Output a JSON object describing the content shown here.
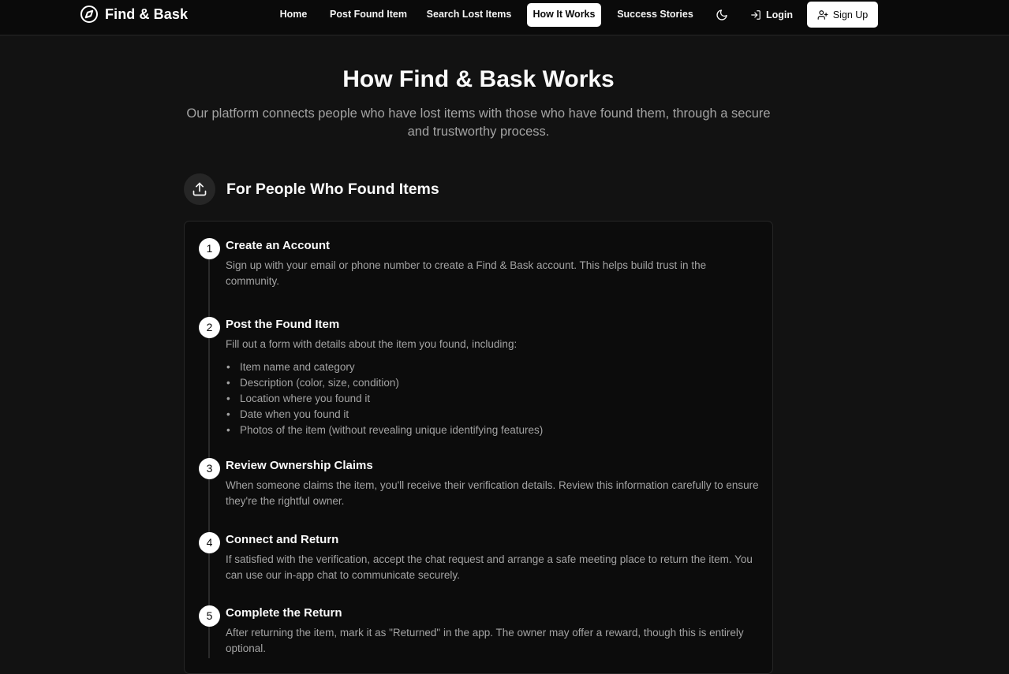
{
  "header": {
    "brand_name": "Find & Bask",
    "nav": [
      {
        "label": "Home"
      },
      {
        "label": "Post Found Item"
      },
      {
        "label": "Search Lost Items"
      },
      {
        "label": "How It Works"
      },
      {
        "label": "Success Stories"
      }
    ],
    "active_nav": "How It Works",
    "theme_toggle_icon": "moon-icon",
    "login_label": "Login",
    "signup_label": "Sign Up"
  },
  "main": {
    "title": "How Find & Bask Works",
    "subtitle": "Our platform connects people who have lost items with those who have found them, through a secure and trustworthy process.",
    "section": {
      "icon": "upload-icon",
      "title": "For People Who Found Items",
      "steps": [
        {
          "number": "1",
          "title": "Create an Account",
          "description": "Sign up with your email or phone number to create a Find & Bask account. This helps build trust in the community."
        },
        {
          "number": "2",
          "title": "Post the Found Item",
          "description": "Fill out a form with details about the item you found, including:",
          "list": [
            "Item name and category",
            "Description (color, size, condition)",
            "Location where you found it",
            "Date when you found it",
            "Photos of the item (without revealing unique identifying features)"
          ]
        },
        {
          "number": "3",
          "title": "Review Ownership Claims",
          "description": "When someone claims the item, you'll receive their verification details. Review this information carefully to ensure they're the rightful owner."
        },
        {
          "number": "4",
          "title": "Connect and Return",
          "description": "If satisfied with the verification, accept the chat request and arrange a safe meeting place to return the item. You can use our in-app chat to communicate securely."
        },
        {
          "number": "5",
          "title": "Complete the Return",
          "description": "After returning the item, mark it as \"Returned\" in the app. The owner may offer a reward, though this is entirely optional."
        }
      ]
    }
  },
  "colors": {
    "background": "#121212",
    "navbar": "#0a0a0a",
    "card": "#0c0c0c",
    "border": "#262626",
    "text_primary": "#fafafa",
    "text_muted": "#a3a3a3",
    "accent": "#ffffff"
  }
}
